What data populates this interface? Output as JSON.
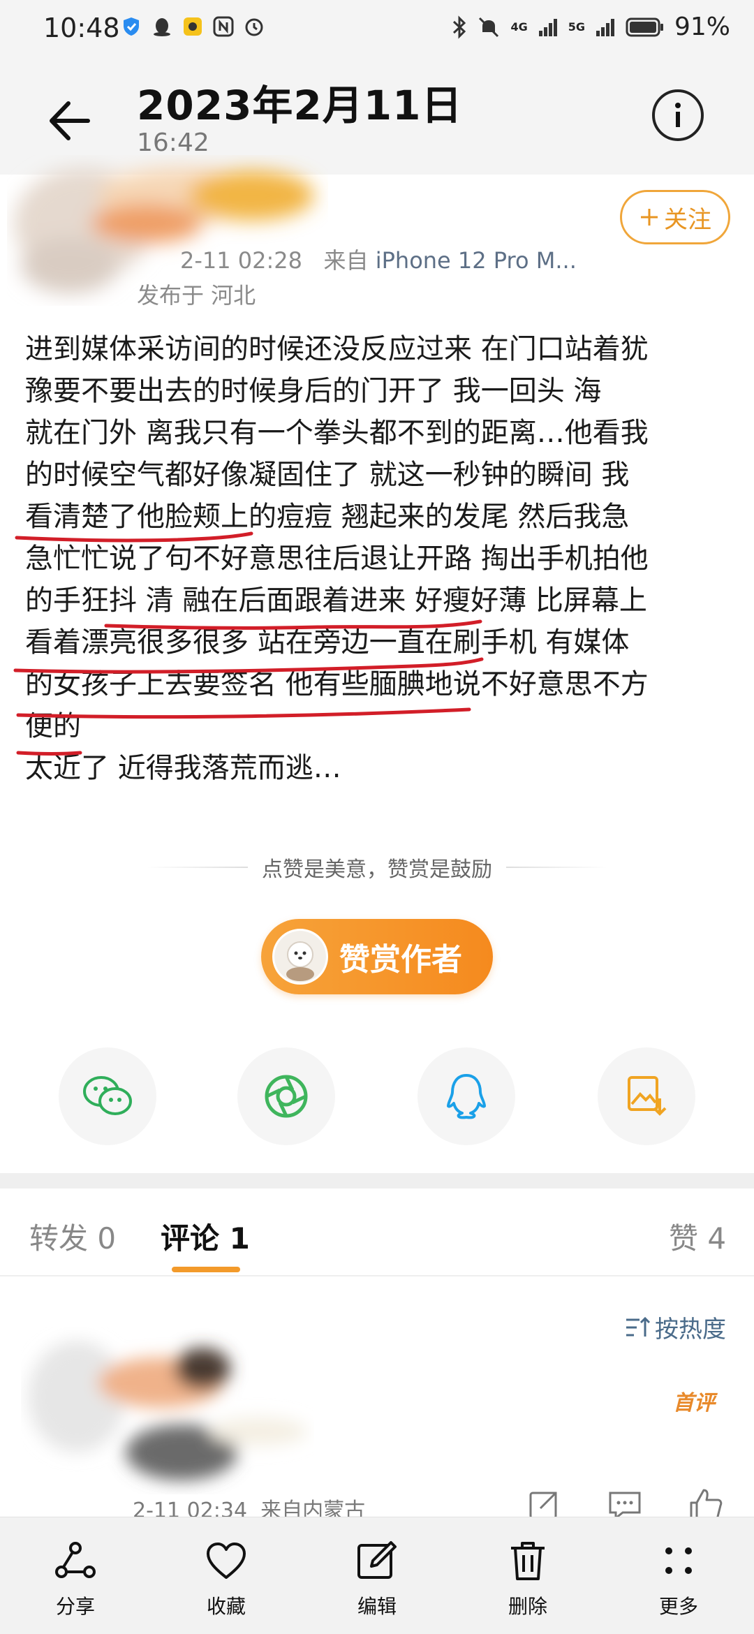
{
  "status_bar": {
    "time": "10:48",
    "battery": "91%",
    "net_1": "4G",
    "net_2": "5G"
  },
  "header": {
    "title": "2023年2月11日",
    "subtitle": "16:42"
  },
  "post": {
    "follow_label": "关注",
    "timestamp": "2-11 02:28",
    "source_prefix": "来自",
    "source": "iPhone 12 Pro M...",
    "location": "发布于 河北",
    "lines": [
      "进到媒体采访间的时候还没反应过来 在门口站着犹",
      "豫要不要出去的时候身后的门开了 我一回头 海",
      "就在门外 离我只有一个拳头都不到的距离…他看我",
      "的时候空气都好像凝固住了 就这一秒钟的瞬间 我",
      "看清楚了他脸颊上的痘痘 翘起来的发尾 然后我急",
      "急忙忙说了句不好意思往后退让开路 掏出手机拍他",
      "的手狂抖 清 融在后面跟着进来 好瘦好薄 比屏幕上",
      "看着漂亮很多很多 站在旁边一直在刷手机 有媒体",
      "的女孩子上去要签名 他有些腼腆地说不好意思不方",
      "便的",
      "太近了 近得我落荒而逃…"
    ]
  },
  "reward": {
    "tip_text": "点赞是美意，赞赏是鼓励",
    "button_label": "赞赏作者"
  },
  "share_icons": [
    "wechat-icon",
    "moments-icon",
    "qq-icon",
    "save-image-icon"
  ],
  "tabs": {
    "repost": "转发 0",
    "comments": "评论 1",
    "likes": "赞 4"
  },
  "comments": {
    "sort_label": "按热度",
    "first_badge": "首评",
    "time": "2-11 02:34",
    "location": "来自内蒙古"
  },
  "toolbar": {
    "share": "分享",
    "favorite": "收藏",
    "edit": "编辑",
    "delete": "删除",
    "more": "更多"
  },
  "colors": {
    "accent": "#f39a2a",
    "underline": "#d21e28",
    "link": "#4a6b8a"
  }
}
